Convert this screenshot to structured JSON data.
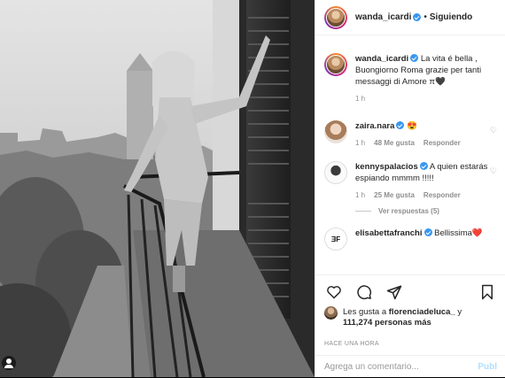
{
  "header": {
    "username": "wanda_icardi",
    "separator": "•",
    "follow_label": "Siguiendo"
  },
  "caption": {
    "username": "wanda_icardi",
    "text": "La vita é bella , Buongiorno Roma grazie per tanti messaggi di Amore π🖤",
    "time": "1 h"
  },
  "comments": [
    {
      "username": "zaira.nara",
      "text": "😍",
      "time": "1 h",
      "likes": "48 Me gusta",
      "reply": "Responder"
    },
    {
      "username": "kennyspalacios",
      "text": "A quien estarás espiando mmmm !!!!!",
      "time": "1 h",
      "likes": "25 Me gusta",
      "reply": "Responder",
      "view_replies": "Ver respuestas (5)"
    },
    {
      "username": "elisabettafranchi",
      "text": "Bellissima❤️"
    }
  ],
  "likes": {
    "prefix": "Les gusta a ",
    "first_user": "florenciadeluca_",
    "conjunction": " y ",
    "count_text": "111,274 personas más"
  },
  "timestamp": "HACE UNA HORA",
  "add_comment": {
    "placeholder": "Agrega un comentario...",
    "publish_label": "Publ"
  },
  "icons": [
    "heart-icon",
    "comment-icon",
    "share-icon",
    "bookmark-icon",
    "tag-user-icon",
    "verified-icon"
  ],
  "colors": {
    "verified": "#3897f0",
    "publish": "#b2dffc",
    "muted": "#8e8e8e",
    "text": "#262626"
  }
}
